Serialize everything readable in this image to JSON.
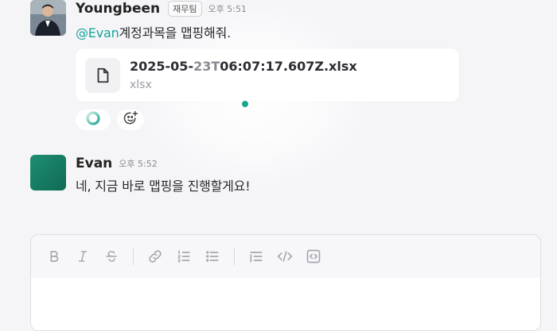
{
  "messages": [
    {
      "author": "Youngbeen",
      "team": "재무팀",
      "time": "오후 5:51",
      "mention": "@Evan",
      "text": "계정과목을 맵핑해줘.",
      "attachment": {
        "name_prefix": "2025-05-",
        "name_dim": "23T",
        "name_rest": "06:07:17.607Z.xlsx",
        "ext": "xlsx",
        "icon": "file-icon"
      }
    },
    {
      "author": "Evan",
      "time": "오후 5:52",
      "text": "네, 지금 바로 맵핑을 진행할게요!"
    }
  ],
  "reactions": [
    {
      "icon": "loading-ring-icon"
    },
    {
      "icon": "add-reaction-icon"
    }
  ],
  "colors": {
    "mention": "#17a597",
    "accent": "#1aa58f",
    "avatar_evan": "#1f8e73"
  },
  "composer": {
    "toolbar": [
      "bold-icon",
      "italic-icon",
      "strikethrough-icon",
      "link-icon",
      "ordered-list-icon",
      "bullet-list-icon",
      "indent-icon",
      "code-icon",
      "code-block-icon"
    ]
  }
}
